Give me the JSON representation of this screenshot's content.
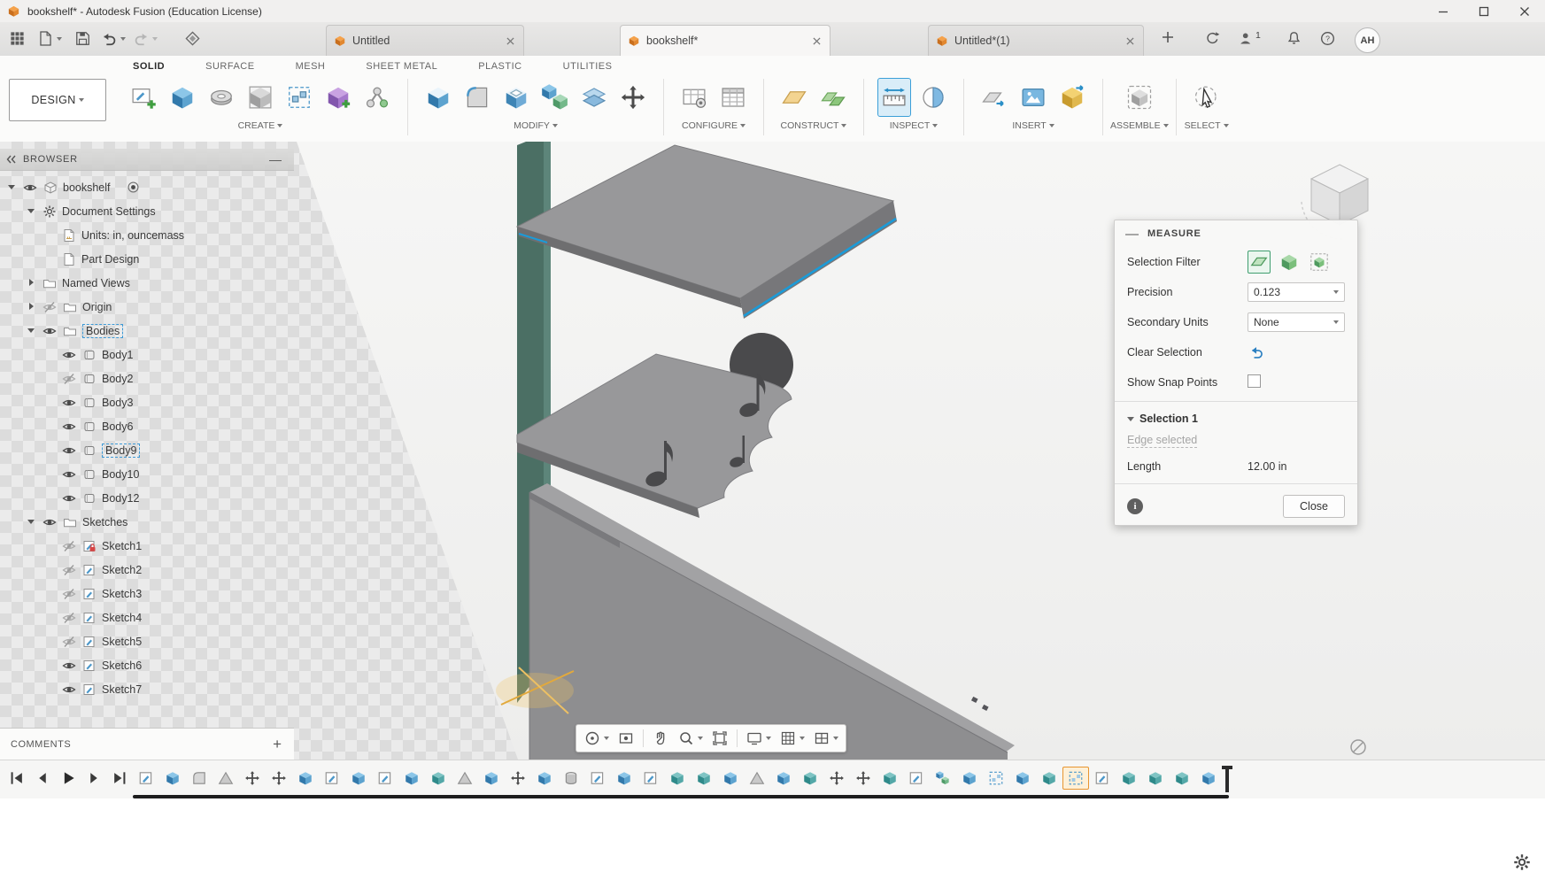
{
  "titlebar": {
    "title": "bookshelf* - Autodesk Fusion (Education License)"
  },
  "qat": {
    "tabs": [
      {
        "label": "Untitled",
        "active": false
      },
      {
        "label": "bookshelf*",
        "active": true
      },
      {
        "label": "Untitled*(1)",
        "active": false
      }
    ],
    "collab_count": "1",
    "avatar_initials": "AH"
  },
  "ribbon": {
    "workspace": "DESIGN",
    "tabs": [
      {
        "label": "SOLID",
        "active": true
      },
      {
        "label": "SURFACE",
        "active": false
      },
      {
        "label": "MESH",
        "active": false
      },
      {
        "label": "SHEET METAL",
        "active": false
      },
      {
        "label": "PLASTIC",
        "active": false
      },
      {
        "label": "UTILITIES",
        "active": false
      }
    ],
    "groups": [
      {
        "label": "CREATE",
        "tools": [
          "create-sketch",
          "extrude",
          "revolve",
          "primitive-box",
          "rectangular-pattern",
          "create-form",
          "joint-origin"
        ]
      },
      {
        "label": "MODIFY",
        "tools": [
          "press-pull",
          "fillet",
          "shell",
          "combine",
          "split-body",
          "move-copy"
        ]
      },
      {
        "label": "CONFIGURE",
        "tools": [
          "configuration",
          "configuration-table"
        ]
      },
      {
        "label": "CONSTRUCT",
        "tools": [
          "offset-plane",
          "midplane"
        ]
      },
      {
        "label": "INSPECT",
        "tools": [
          "measure",
          "section-analysis"
        ],
        "active_tool": "measure"
      },
      {
        "label": "INSERT",
        "tools": [
          "insert-derive",
          "decal",
          "insert-mesh"
        ]
      },
      {
        "label": "ASSEMBLE",
        "tools": [
          "new-component"
        ]
      },
      {
        "label": "SELECT",
        "tools": [
          "select"
        ]
      }
    ]
  },
  "browser": {
    "title": "BROWSER",
    "rows": [
      {
        "label": "bookshelf",
        "depth": 0,
        "icon": "component",
        "chevron": "down",
        "eye": "on",
        "radio": true
      },
      {
        "label": "Document Settings",
        "depth": 1,
        "icon": "gear",
        "chevron": "down"
      },
      {
        "label": "Units: in, ouncemass",
        "depth": 2,
        "icon": "units"
      },
      {
        "label": "Part Design",
        "depth": 2,
        "icon": "doc"
      },
      {
        "label": "Named Views",
        "depth": 1,
        "icon": "folder",
        "chevron": "right"
      },
      {
        "label": "Origin",
        "depth": 1,
        "icon": "folder",
        "chevron": "right",
        "eye": "off"
      },
      {
        "label": "Bodies",
        "depth": 1,
        "icon": "folder",
        "chevron": "down",
        "eye": "on",
        "selected": true
      },
      {
        "label": "Body1",
        "depth": 2,
        "icon": "body",
        "eye": "on"
      },
      {
        "label": "Body2",
        "depth": 2,
        "icon": "body",
        "eye": "off"
      },
      {
        "label": "Body3",
        "depth": 2,
        "icon": "body",
        "eye": "on"
      },
      {
        "label": "Body6",
        "depth": 2,
        "icon": "body",
        "eye": "on"
      },
      {
        "label": "Body9",
        "depth": 2,
        "icon": "body",
        "eye": "on",
        "selected": true
      },
      {
        "label": "Body10",
        "depth": 2,
        "icon": "body",
        "eye": "on"
      },
      {
        "label": "Body12",
        "depth": 2,
        "icon": "body",
        "eye": "on"
      },
      {
        "label": "Sketches",
        "depth": 1,
        "icon": "folder",
        "chevron": "down",
        "eye": "on"
      },
      {
        "label": "Sketch1",
        "depth": 2,
        "icon": "sketch-locked",
        "eye": "off"
      },
      {
        "label": "Sketch2",
        "depth": 2,
        "icon": "sketch",
        "eye": "off"
      },
      {
        "label": "Sketch3",
        "depth": 2,
        "icon": "sketch",
        "eye": "off"
      },
      {
        "label": "Sketch4",
        "depth": 2,
        "icon": "sketch",
        "eye": "off"
      },
      {
        "label": "Sketch5",
        "depth": 2,
        "icon": "sketch",
        "eye": "off"
      },
      {
        "label": "Sketch6",
        "depth": 2,
        "icon": "sketch",
        "eye": "on"
      },
      {
        "label": "Sketch7",
        "depth": 2,
        "icon": "sketch",
        "eye": "on"
      }
    ]
  },
  "comments": {
    "label": "COMMENTS"
  },
  "navbar": {
    "items": [
      {
        "name": "orbit",
        "caret": true
      },
      {
        "name": "look-at",
        "caret": false
      },
      {
        "name": "pan",
        "caret": false
      },
      {
        "name": "zoom",
        "caret": true
      },
      {
        "name": "fit",
        "caret": false
      },
      {
        "name": "display-settings",
        "caret": true
      },
      {
        "name": "grid-settings",
        "caret": true
      },
      {
        "name": "viewports",
        "caret": true
      }
    ]
  },
  "measure": {
    "title": "MEASURE",
    "rows": {
      "selection_filter": "Selection Filter",
      "precision": "Precision",
      "precision_value": "0.123",
      "secondary_units": "Secondary Units",
      "secondary_units_value": "None",
      "clear_selection": "Clear Selection",
      "show_snap_points": "Show Snap Points"
    },
    "selection": {
      "header": "Selection 1",
      "detail": "Edge selected",
      "length_label": "Length",
      "length_value": "12.00 in"
    },
    "close_label": "Close"
  },
  "timeline": {
    "features": [
      "sketch",
      "extrude",
      "fillet",
      "loft",
      "move",
      "move",
      "extrude",
      "sketch",
      "extrude",
      "sketch",
      "extrude",
      "box",
      "loft",
      "extrude",
      "move",
      "extrude",
      "hole",
      "sketch",
      "extrude",
      "sketch",
      "box",
      "box",
      "extrude",
      "loft",
      "extrude",
      "box",
      "move",
      "move",
      "box",
      "sketch",
      "combine",
      "extrude",
      "pattern",
      "extrude",
      "box",
      "pattern",
      "sketch",
      "box",
      "box",
      "box",
      "extrude"
    ],
    "highlight_index": 35
  },
  "colors": {
    "accent_blue": "#1b9bd8",
    "selection_dash": "#3e9ad6",
    "panel_teal": "#4b6f64",
    "highlight_orange": "#e8952f",
    "document_cube_orange": "#f0913d"
  }
}
